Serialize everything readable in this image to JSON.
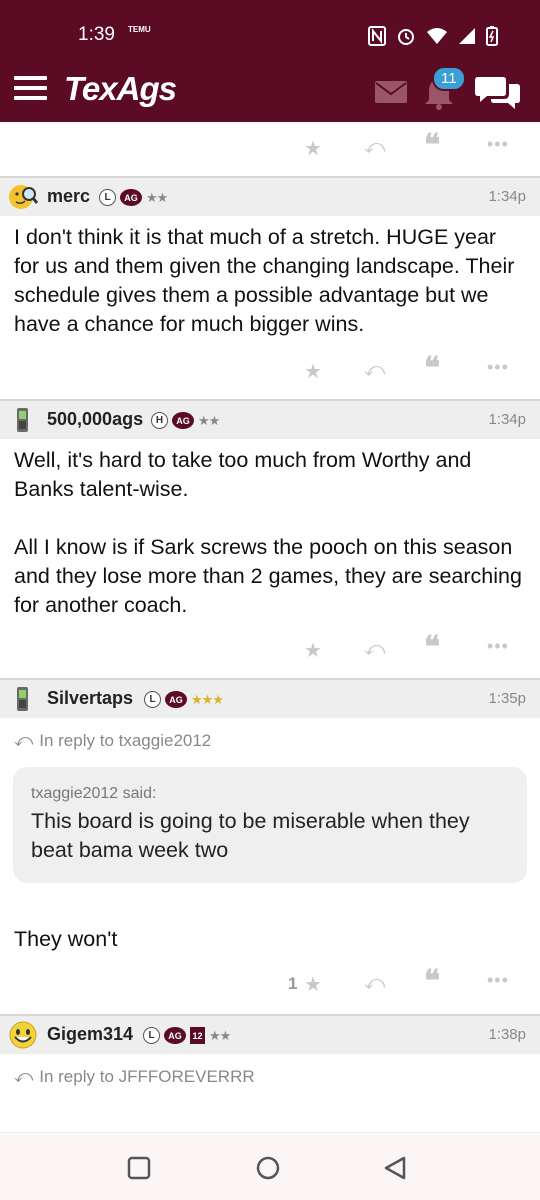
{
  "status_bar": {
    "time": "1:39",
    "carrier_badge": "TEMU"
  },
  "app": {
    "title": "TexAgs",
    "notification_count": "11"
  },
  "posts": [
    {
      "username": "merc",
      "badge_l": "L",
      "badge_ag": "AG",
      "stars": "★★",
      "time": "1:34p",
      "avatar": "magnifier-smiley-icon",
      "body": "I don't think it is that much of a stretch. HUGE year for us and them given the changing landscape. Their schedule gives them a possible advantage but we have a chance for much bigger wins."
    },
    {
      "username": "500,000ags",
      "badge_h": "H",
      "badge_ag": "AG",
      "stars": "★★",
      "time": "1:34p",
      "avatar": "phone-icon",
      "body_p1": "Well, it's hard to take too much from Worthy and Banks talent-wise.",
      "body_p2": "All I know is if Sark screws the pooch on this season and they lose more than 2 games, they are searching for another coach."
    },
    {
      "username": "Silvertaps",
      "badge_l": "L",
      "badge_ag": "AG",
      "stars": "★★★",
      "time": "1:35p",
      "avatar": "phone-icon",
      "reply_to": "In reply to txaggie2012",
      "quote_author": "txaggie2012 said:",
      "quote_text": "This board is going to be miserable when they beat bama week two",
      "body": "They won't",
      "star_count": "1"
    },
    {
      "username": "Gigem314",
      "badge_l": "L",
      "badge_ag": "AG",
      "badge_12": "12",
      "stars": "★★",
      "time": "1:38p",
      "avatar": "smiley-icon",
      "reply_to": "In reply to JFFFOREVERRR"
    }
  ],
  "icons": {
    "star": "★",
    "reply": "⤺",
    "quote": "❝",
    "more": "•••"
  },
  "colors": {
    "brand": "#5b0b24",
    "badge_blue": "#3a9fd4",
    "gold_star": "#d7b32a"
  }
}
